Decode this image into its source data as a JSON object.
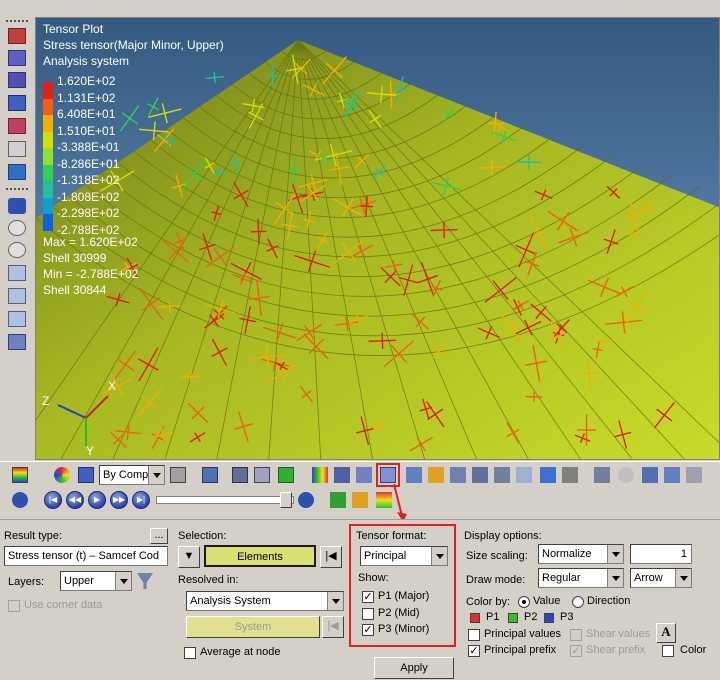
{
  "legend": {
    "title_lines": [
      "Tensor Plot",
      "Stress tensor(Major Minor, Upper)",
      "Analysis system"
    ],
    "scale": [
      {
        "value": "1.620E+02",
        "color": "#e02010"
      },
      {
        "value": "1.131E+02",
        "color": "#f06010"
      },
      {
        "value": "6.408E+01",
        "color": "#f0b000"
      },
      {
        "value": "1.510E+01",
        "color": "#d0e000"
      },
      {
        "value": "-3.388E+01",
        "color": "#90e030"
      },
      {
        "value": "-8.286E+01",
        "color": "#30d050"
      },
      {
        "value": "-1.318E+02",
        "color": "#20c0a0"
      },
      {
        "value": "-1.808E+02",
        "color": "#10a0d0"
      },
      {
        "value": "-2.298E+02",
        "color": "#1060e0"
      },
      {
        "value": "-2.788E+02",
        "color": "#1020c0"
      }
    ],
    "stats": [
      "Max = 1.620E+02",
      "Shell 30999",
      "Min = -2.788E+02",
      "Shell 30844"
    ]
  },
  "axes": {
    "x": "X",
    "y": "Y",
    "z": "Z"
  },
  "toolbar": {
    "color_mode": "By Comp"
  },
  "panel": {
    "result_type_label": "Result type:",
    "result_type_value": "Stress tensor (t) – Samcef Cod",
    "ellipsis": "...",
    "layers_label": "Layers:",
    "layers_value": "Upper",
    "use_corner_data": "Use corner data",
    "selection_label": "Selection:",
    "selection_value": "Elements",
    "resolved_in_label": "Resolved in:",
    "resolved_in_value": "Analysis System",
    "system_button": "System",
    "average_at_node": "Average at node",
    "tensor_format_label": "Tensor format:",
    "tensor_format_value": "Principal",
    "show_label": "Show:",
    "show_options": [
      {
        "label": "P1 (Major)",
        "checked": true
      },
      {
        "label": "P2 (Mid)",
        "checked": false
      },
      {
        "label": "P3 (Minor)",
        "checked": true
      }
    ],
    "apply_button": "Apply",
    "display_options_label": "Display options:",
    "size_scaling_label": "Size scaling:",
    "size_scaling_value": "Normalize",
    "size_scaling_number": "1",
    "draw_mode_label": "Draw mode:",
    "draw_mode_value": "Regular",
    "draw_mode_style": "Arrow",
    "color_by_label": "Color by:",
    "color_by_value": "Value",
    "color_by_direction": "Direction",
    "p_colors": [
      {
        "label": "P1",
        "color": "#e03030"
      },
      {
        "label": "P2",
        "color": "#30c030"
      },
      {
        "label": "P3",
        "color": "#3040d0"
      }
    ],
    "principal_values": "Principal values",
    "shear_values": "Shear values",
    "principal_prefix": "Principal prefix",
    "shear_prefix": "Shear prefix",
    "font_button": "A",
    "color_label": "Color"
  }
}
